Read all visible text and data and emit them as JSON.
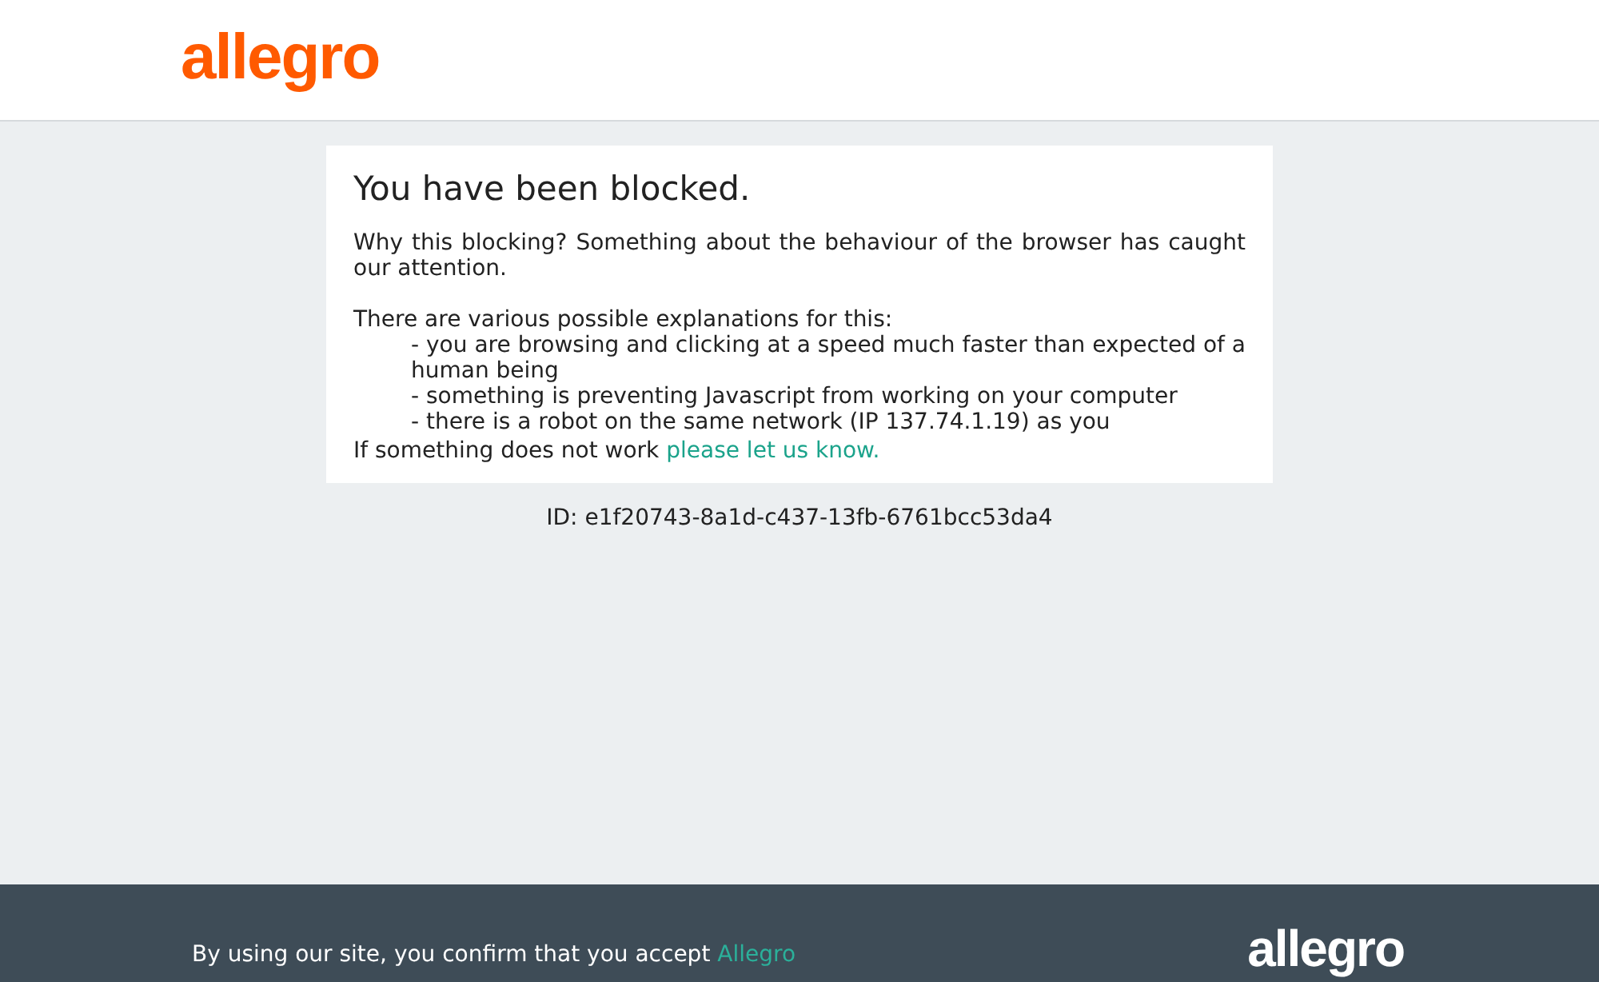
{
  "header": {
    "logo": "allegro"
  },
  "notice": {
    "title": "You have been blocked.",
    "intro": "Why this blocking? Something about the behaviour of the browser has caught our attention.",
    "reasons_heading": "There are various possible explanations for this:",
    "reasons": [
      "- you are browsing and clicking at a speed much faster than expected of a human being",
      "- something is preventing Javascript from working on your computer",
      "- there is a robot on the same network (IP 137.74.1.19) as you"
    ],
    "contact_text": "If something does not work",
    "contact_link": "please let us know."
  },
  "request_id": "ID: e1f20743-8a1d-c437-13fb-6761bcc53da4",
  "footer": {
    "text": "By using our site, you confirm that you accept",
    "link": "Allegro",
    "logo": "allegro"
  }
}
